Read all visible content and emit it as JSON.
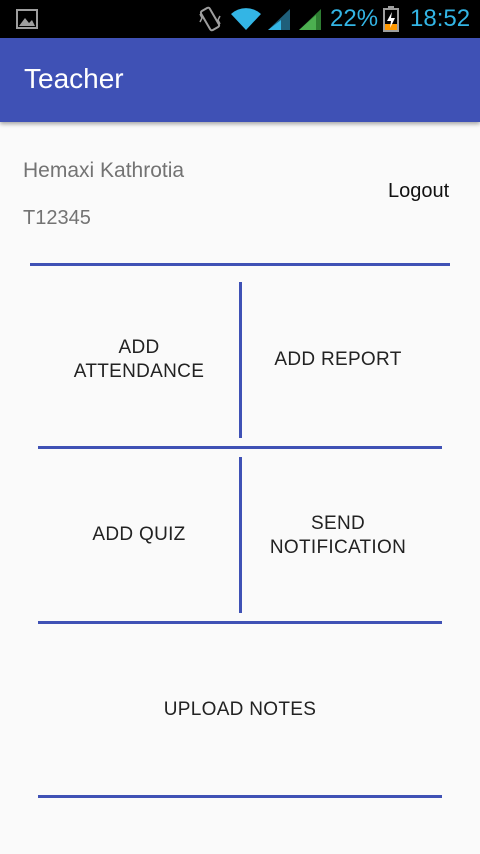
{
  "status_bar": {
    "battery_percent": "22%",
    "time": "18:52",
    "icons": [
      "gallery-icon",
      "vibrate-icon",
      "wifi-icon",
      "signal-icon",
      "signal-icon",
      "battery-charging-icon"
    ],
    "icon_color": "#33b5e5"
  },
  "app_bar": {
    "title": "Teacher",
    "color": "#3f51b5"
  },
  "profile": {
    "name": "Hemaxi Kathrotia",
    "id": "T12345"
  },
  "logout_label": "Logout",
  "menu": {
    "add_attendance": {
      "line1": "ADD",
      "line2": "ATTENDANCE"
    },
    "add_report": "ADD REPORT",
    "add_quiz": "ADD QUIZ",
    "send_notification": {
      "line1": "SEND",
      "line2": "NOTIFICATION"
    },
    "upload_notes": "UPLOAD NOTES"
  },
  "accent_color": "#3f51b5"
}
